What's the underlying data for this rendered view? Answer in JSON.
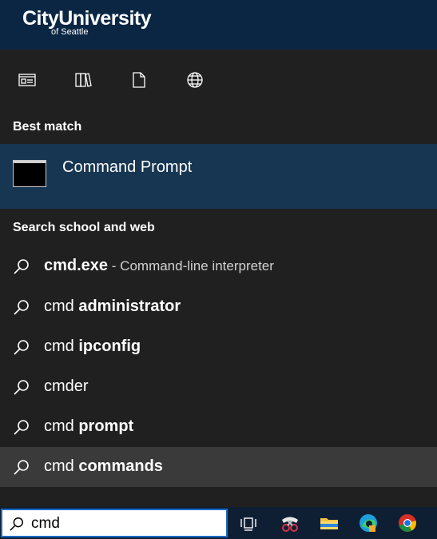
{
  "brand": {
    "name": "CityUniversity",
    "sub": "of Seattle"
  },
  "filters": [
    {
      "icon": "apps-filter-icon"
    },
    {
      "icon": "documents-filter-icon"
    },
    {
      "icon": "file-filter-icon"
    },
    {
      "icon": "web-filter-icon"
    }
  ],
  "best_match": {
    "heading": "Best match",
    "title": "Command Prompt",
    "icon": "command-prompt-icon"
  },
  "web": {
    "heading": "Search school and web",
    "results": [
      {
        "plain": "",
        "bold": "cmd.exe",
        "desc": " - Command-line interpreter"
      },
      {
        "plain": "cmd ",
        "bold": "administrator",
        "desc": ""
      },
      {
        "plain": "cmd ",
        "bold": "ipconfig",
        "desc": ""
      },
      {
        "plain": "cmder",
        "bold": "",
        "desc": ""
      },
      {
        "plain": "cmd ",
        "bold": "prompt",
        "desc": ""
      },
      {
        "plain": "cmd ",
        "bold": "commands",
        "desc": ""
      }
    ]
  },
  "taskbar": {
    "search_value": "cmd",
    "apps": [
      "task-view-icon",
      "snipping-tool-icon",
      "file-explorer-icon",
      "edge-icon",
      "chrome-icon"
    ]
  },
  "colors": {
    "banner": "#0a2642",
    "panel": "#202020",
    "selected": "#173652",
    "hover": "#3a3a3a",
    "taskbar": "#0f1f33",
    "accent": "#1d6cc8"
  }
}
